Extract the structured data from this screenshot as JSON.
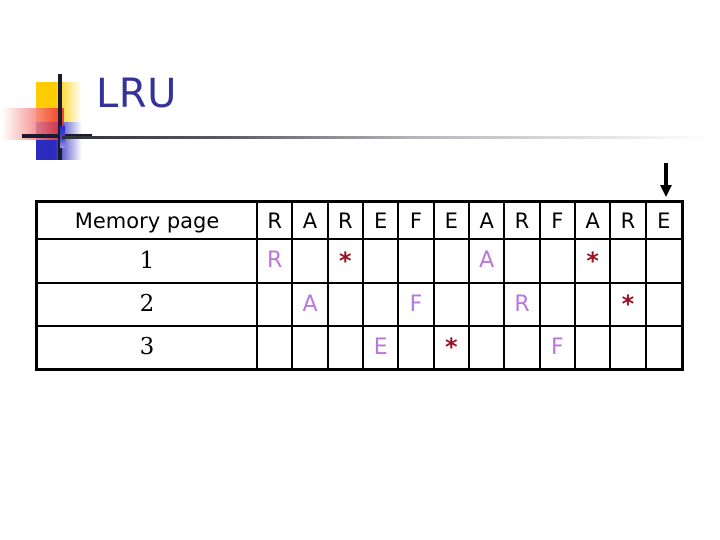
{
  "slide": {
    "title": "LRU",
    "title_color": "#333399"
  },
  "decoration": {
    "colors": {
      "yellow": "#FFCC00",
      "blue": "#2B2BC0",
      "red": "#F03030",
      "bar": "#1B1B2E"
    }
  },
  "pointer": {
    "icon": "down-arrow-icon",
    "points_to_column_index": 11
  },
  "table": {
    "row_header_label": "Memory page",
    "reference_string": [
      "R",
      "A",
      "R",
      "E",
      "F",
      "E",
      "A",
      "R",
      "F",
      "A",
      "R",
      "E"
    ],
    "frame_colors": {
      "page_letter": "#BB77DD",
      "hit_marker": "#991122"
    },
    "hit_marker_glyph": "*",
    "rows": [
      {
        "label": "1",
        "cells": [
          "R",
          "",
          "*",
          "",
          "",
          "",
          "A",
          "",
          "",
          "*",
          "",
          ""
        ]
      },
      {
        "label": "2",
        "cells": [
          "",
          "A",
          "",
          "",
          "F",
          "",
          "",
          "R",
          "",
          "",
          "*",
          ""
        ]
      },
      {
        "label": "3",
        "cells": [
          "",
          "",
          "",
          "E",
          "",
          "*",
          "",
          "",
          "F",
          "",
          "",
          ""
        ]
      }
    ]
  }
}
